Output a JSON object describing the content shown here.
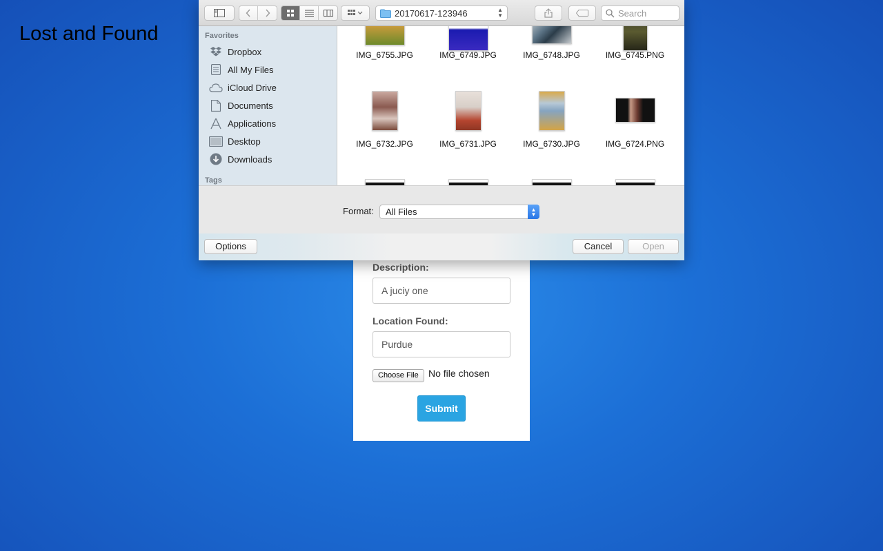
{
  "page": {
    "title": "Lost and Found"
  },
  "form": {
    "description_label": "Description:",
    "description_value": "A juciy one",
    "location_label": "Location Found:",
    "location_value": "Purdue",
    "choose_file_label": "Choose File",
    "no_file_text": "No file chosen",
    "submit_label": "Submit"
  },
  "dialog": {
    "toolbar": {
      "current_folder": "20170617-123946",
      "search_placeholder": "Search",
      "active_view": "icon"
    },
    "sidebar": {
      "favorites_heading": "Favorites",
      "items": [
        {
          "label": "Dropbox",
          "icon": "dropbox-icon"
        },
        {
          "label": "All My Files",
          "icon": "all-files-icon"
        },
        {
          "label": "iCloud Drive",
          "icon": "cloud-icon"
        },
        {
          "label": "Documents",
          "icon": "document-icon"
        },
        {
          "label": "Applications",
          "icon": "applications-icon"
        },
        {
          "label": "Desktop",
          "icon": "desktop-icon"
        },
        {
          "label": "Downloads",
          "icon": "download-icon"
        }
      ],
      "tags_heading": "Tags"
    },
    "files": [
      {
        "name": "IMG_6755.JPG"
      },
      {
        "name": "IMG_6749.JPG"
      },
      {
        "name": "IMG_6748.JPG"
      },
      {
        "name": "IMG_6745.PNG"
      },
      {
        "name": "IMG_6732.JPG"
      },
      {
        "name": "IMG_6731.JPG"
      },
      {
        "name": "IMG_6730.JPG"
      },
      {
        "name": "IMG_6724.PNG"
      }
    ],
    "format_label": "Format:",
    "format_value": "All Files",
    "options_label": "Options",
    "cancel_label": "Cancel",
    "open_label": "Open"
  },
  "colors": {
    "background": "#1c6fd6",
    "submit": "#2aa4e2",
    "sidebar": "#dce6ee"
  }
}
